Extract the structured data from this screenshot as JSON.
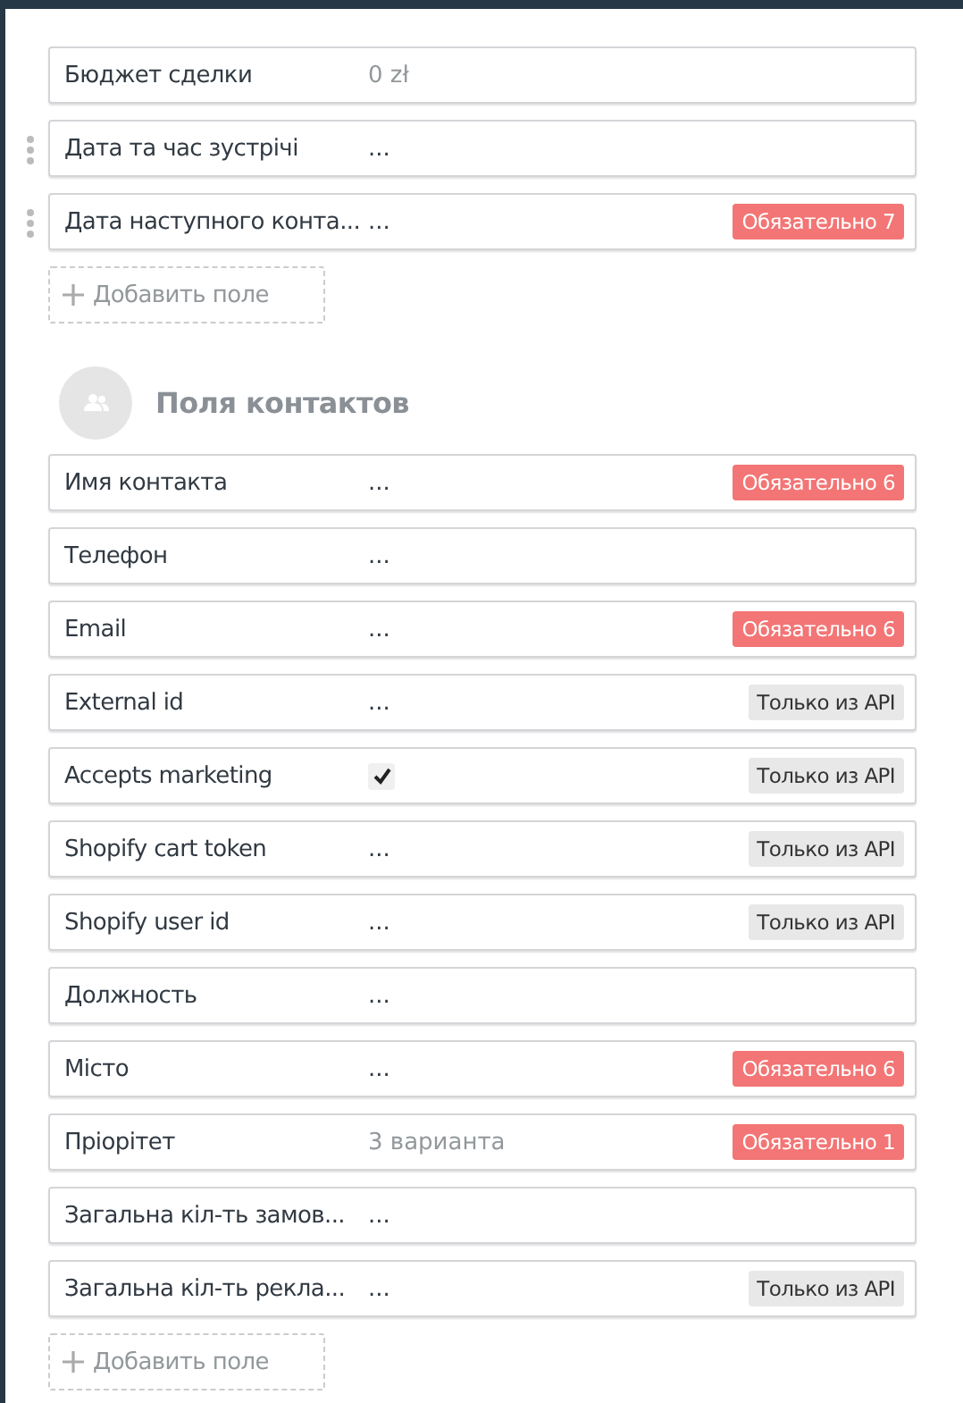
{
  "lead_fields": [
    {
      "kind": "text",
      "label": "Бюджет сделки",
      "placeholder": "0 zł",
      "draggable": false
    },
    {
      "kind": "text",
      "label": "Дата та час зустрічі",
      "value": "...",
      "draggable": true
    },
    {
      "kind": "text",
      "label": "Дата наступного конта...",
      "value": "...",
      "draggable": true,
      "badge": {
        "kind": "required",
        "text": "Обязательно 7"
      }
    }
  ],
  "lead_add_button": "Добавить поле",
  "contacts_section": {
    "title": "Поля контактов",
    "fields": [
      {
        "kind": "text",
        "label": "Имя контакта",
        "value": "...",
        "badge": {
          "kind": "required",
          "text": "Обязательно 6"
        }
      },
      {
        "kind": "text",
        "label": "Телефон",
        "value": "..."
      },
      {
        "kind": "text",
        "label": "Email",
        "value": "...",
        "badge": {
          "kind": "required",
          "text": "Обязательно 6"
        }
      },
      {
        "kind": "text",
        "label": "External id",
        "value": "...",
        "badge": {
          "kind": "api",
          "text": "Только из API"
        }
      },
      {
        "kind": "checkbox",
        "label": "Accepts marketing",
        "checked": true,
        "badge": {
          "kind": "api",
          "text": "Только из API"
        }
      },
      {
        "kind": "text",
        "label": "Shopify cart token",
        "value": "...",
        "badge": {
          "kind": "api",
          "text": "Только из API"
        }
      },
      {
        "kind": "text",
        "label": "Shopify user id",
        "value": "...",
        "badge": {
          "kind": "api",
          "text": "Только из API"
        }
      },
      {
        "kind": "text",
        "label": "Должность",
        "value": "..."
      },
      {
        "kind": "text",
        "label": "Місто",
        "value": "...",
        "badge": {
          "kind": "required",
          "text": "Обязательно 6"
        }
      },
      {
        "kind": "text",
        "label": "Пріорітет",
        "placeholder": "3 варианта",
        "badge": {
          "kind": "required",
          "text": "Обязательно 1"
        }
      },
      {
        "kind": "text",
        "label": "Загальна кіл-ть замов...",
        "value": "..."
      },
      {
        "kind": "text",
        "label": "Загальна кіл-ть рекла...",
        "value": "...",
        "badge": {
          "kind": "api",
          "text": "Только из API"
        }
      }
    ],
    "add_button": "Добавить поле"
  }
}
